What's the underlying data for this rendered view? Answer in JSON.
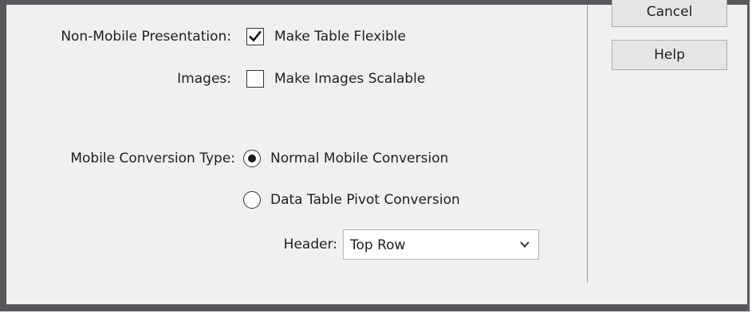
{
  "buttons": {
    "cancel": "Cancel",
    "help": "Help"
  },
  "non_mobile": {
    "label": "Non-Mobile Presentation:",
    "checkbox_label": "Make Table Flexible",
    "checked": true
  },
  "images": {
    "label": "Images:",
    "checkbox_label": "Make Images Scalable",
    "checked": false
  },
  "mobile_conversion": {
    "label": "Mobile Conversion Type:",
    "options": [
      {
        "label": "Normal Mobile Conversion",
        "selected": true
      },
      {
        "label": "Data Table Pivot Conversion",
        "selected": false
      }
    ]
  },
  "header": {
    "label": "Header:",
    "selected_value": "Top Row"
  },
  "icons": {
    "check": "checkmark-icon",
    "dropdown": "chevron-down-icon"
  }
}
